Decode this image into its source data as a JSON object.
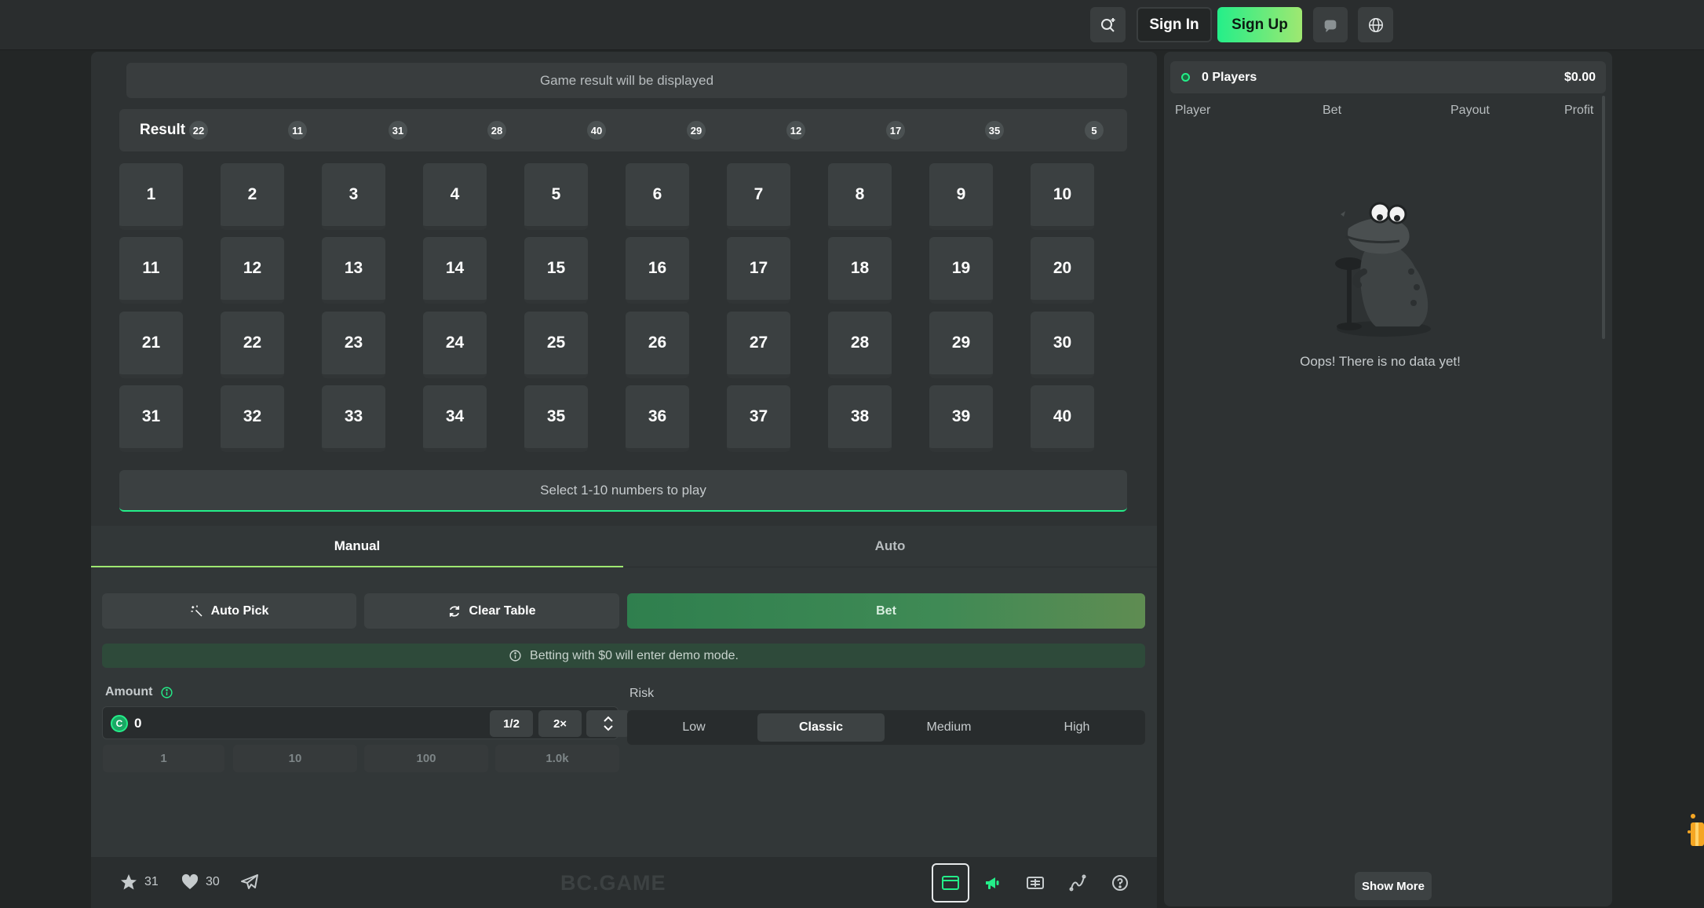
{
  "header": {
    "signin_label": "Sign In",
    "signup_label": "Sign Up",
    "accent": "#24ee89"
  },
  "game": {
    "result_message": "Game result will be displayed",
    "result_label": "Result",
    "results": [
      "22",
      "11",
      "31",
      "28",
      "40",
      "29",
      "12",
      "17",
      "35",
      "5"
    ],
    "numbers": [
      "1",
      "2",
      "3",
      "4",
      "5",
      "6",
      "7",
      "8",
      "9",
      "10",
      "11",
      "12",
      "13",
      "14",
      "15",
      "16",
      "17",
      "18",
      "19",
      "20",
      "21",
      "22",
      "23",
      "24",
      "25",
      "26",
      "27",
      "28",
      "29",
      "30",
      "31",
      "32",
      "33",
      "34",
      "35",
      "36",
      "37",
      "38",
      "39",
      "40"
    ],
    "select_hint": "Select 1-10 numbers to play"
  },
  "controls": {
    "tabs": [
      "Manual",
      "Auto"
    ],
    "active_tab": "Manual",
    "autopick_label": "Auto Pick",
    "clear_label": "Clear Table",
    "bet_label": "Bet",
    "demo_notice": "Betting with $0 will enter demo mode.",
    "amount_label": "Amount",
    "amount_value": "0",
    "half_label": "1/2",
    "double_label": "2×",
    "presets": [
      "1",
      "10",
      "100",
      "1.0k"
    ],
    "risk_label": "Risk",
    "risk_options": [
      "Low",
      "Classic",
      "Medium",
      "High"
    ],
    "risk_selected": "Classic"
  },
  "footer": {
    "stars": "31",
    "likes": "30",
    "brand": "BC.GAME"
  },
  "sidebar": {
    "players_label": "0 Players",
    "total": "$0.00",
    "columns": [
      "Player",
      "Bet",
      "Payout",
      "Profit"
    ],
    "empty_text": "Oops! There is no data yet!",
    "show_more_label": "Show More"
  }
}
